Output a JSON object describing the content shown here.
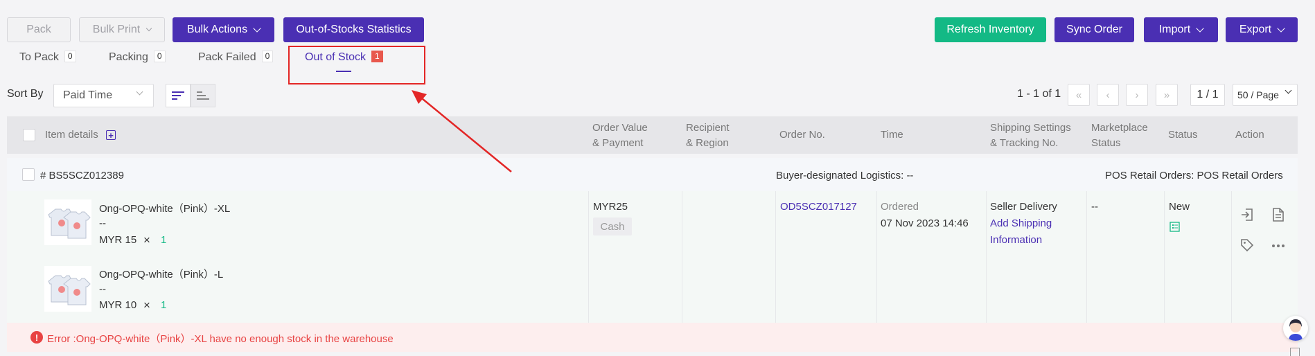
{
  "toolbar": {
    "pack_label": "Pack",
    "bulk_print_label": "Bulk Print",
    "bulk_actions_label": "Bulk Actions",
    "oos_stats_label": "Out-of-Stocks Statistics",
    "refresh_inventory_label": "Refresh Inventory",
    "sync_order_label": "Sync Order",
    "import_label": "Import",
    "export_label": "Export"
  },
  "tabs": [
    {
      "label": "To Pack",
      "count": "0"
    },
    {
      "label": "Packing",
      "count": "0"
    },
    {
      "label": "Pack Failed",
      "count": "0"
    },
    {
      "label": "Out of Stock",
      "count": "1",
      "active": true
    }
  ],
  "sort": {
    "label": "Sort By",
    "selected": "Paid Time"
  },
  "pagination": {
    "range_text": "1 - 1 of 1",
    "page_input": "1 / 1",
    "page_size": "50 / Page"
  },
  "table": {
    "headers": {
      "item_details": "Item details",
      "order_value_1": "Order Value",
      "order_value_2": "& Payment",
      "recipient_1": "Recipient",
      "recipient_2": "& Region",
      "order_no": "Order No.",
      "time": "Time",
      "shipping_1": "Shipping Settings",
      "shipping_2": "& Tracking No.",
      "marketplace_1": "Marketplace",
      "marketplace_2": "Status",
      "status": "Status",
      "action": "Action"
    }
  },
  "order": {
    "package_no": "# BS5SCZ012389",
    "logistics": "Buyer-designated Logistics: --",
    "channel": "POS Retail Orders: POS Retail Orders",
    "items": [
      {
        "name": "Ong-OPQ-white（Pink）-XL",
        "sku": "--",
        "price": "MYR 15",
        "times": "×",
        "qty": "1"
      },
      {
        "name": "Ong-OPQ-white（Pink）-L",
        "sku": "--",
        "price": "MYR 10",
        "times": "×",
        "qty": "1"
      }
    ],
    "order_value": "MYR25",
    "payment": "Cash",
    "order_no": "OD5SCZ017127",
    "time_label": "Ordered",
    "time_value": "07 Nov 2023 14:46",
    "shipping_method": "Seller Delivery",
    "add_shipping_1": "Add Shipping",
    "add_shipping_2": "Information",
    "marketplace_status": "--",
    "status": "New",
    "error": "Error :Ong-OPQ-white（Pink）-XL have no enough stock in the warehouse"
  },
  "colors": {
    "primary": "#4a2fb3",
    "success": "#13b985",
    "danger": "#e84343",
    "highlight": "#e32626"
  }
}
